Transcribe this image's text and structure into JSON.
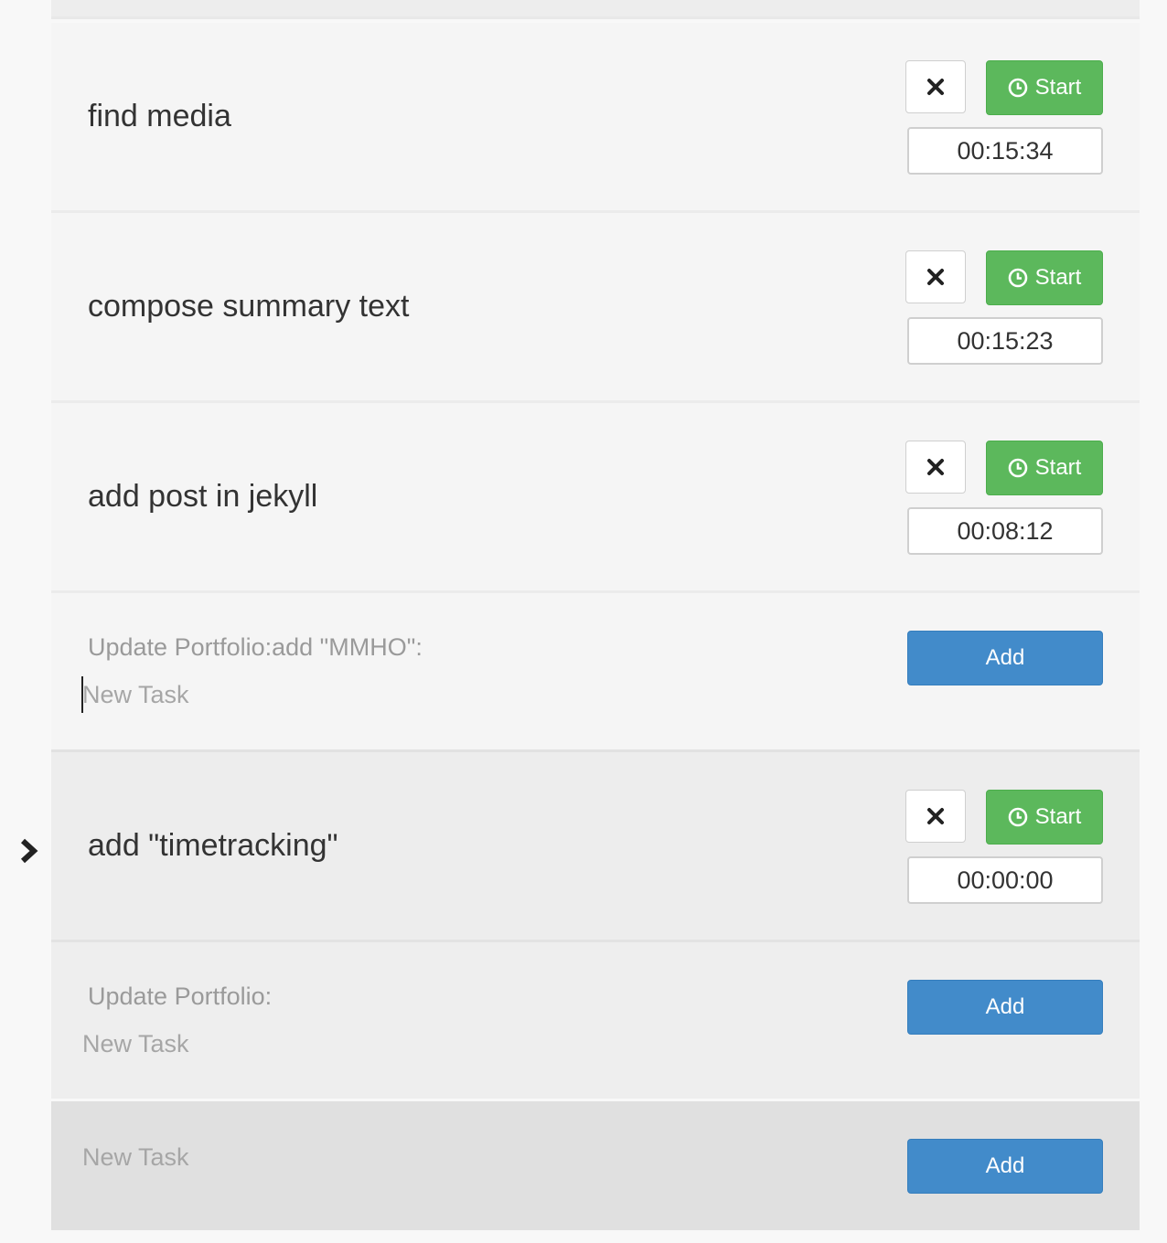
{
  "tasks": [
    {
      "title": "find media",
      "time": "00:15:34"
    },
    {
      "title": "compose summary text",
      "time": "00:15:23"
    },
    {
      "title": "add post in jekyll",
      "time": "00:08:12"
    },
    {
      "title": "add \"timetracking\"",
      "time": "00:00:00"
    }
  ],
  "groups": [
    {
      "label": "Update Portfolio:add \"MMHO\":"
    },
    {
      "label": "Update Portfolio:"
    }
  ],
  "labels": {
    "start": "Start",
    "add": "Add",
    "new_task_placeholder": "New Task"
  },
  "icons": {
    "delete": "close-icon",
    "start": "clock-icon",
    "current": "chevron-right-icon"
  },
  "colors": {
    "start_button": "#5cb85c",
    "add_button": "#428bca"
  }
}
